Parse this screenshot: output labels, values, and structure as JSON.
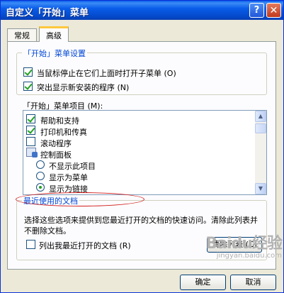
{
  "window": {
    "title": "自定义「开始」菜单"
  },
  "titlebar": {
    "help_label": "?",
    "close_label": "✕"
  },
  "tabs": [
    {
      "label": "常规"
    },
    {
      "label": "高级"
    }
  ],
  "start_settings": {
    "legend": "「开始」菜单设置",
    "options": [
      {
        "label": "当鼠标停止在它们上面时打开子菜单 (O)",
        "checked": true
      },
      {
        "label": "突出显示新安装的程序 (N)",
        "checked": true
      }
    ]
  },
  "start_items": {
    "label": "「开始」菜单项目 (M):",
    "items": [
      {
        "type": "checkbox",
        "label": "帮助和支持",
        "checked": true
      },
      {
        "type": "checkbox",
        "label": "打印机和传真",
        "checked": true
      },
      {
        "type": "checkbox",
        "label": "滚动程序",
        "checked": false
      },
      {
        "type": "header",
        "label": "控制面板"
      },
      {
        "type": "radio",
        "label": "不显示此项目",
        "checked": false
      },
      {
        "type": "radio",
        "label": "显示为菜单",
        "checked": false
      },
      {
        "type": "radio",
        "label": "显示为链接",
        "checked": true
      }
    ]
  },
  "recent_docs": {
    "legend": "最近使用的文档",
    "description": "选择这些选项来提供到您最近打开的文档的快速访问。清除此列表并不删除文档。",
    "checkbox_label": "列出我最近打开的文档 (R)",
    "checkbox_checked": false,
    "clear_button_label": "清除列表 (C)"
  },
  "footer": {
    "ok_label": "确定",
    "cancel_label": "取消"
  },
  "watermark": {
    "line1": "Baidu经验",
    "line2": "jingyan.baidu.com"
  },
  "scrollbar": {
    "up": "▲",
    "down": "▼"
  }
}
